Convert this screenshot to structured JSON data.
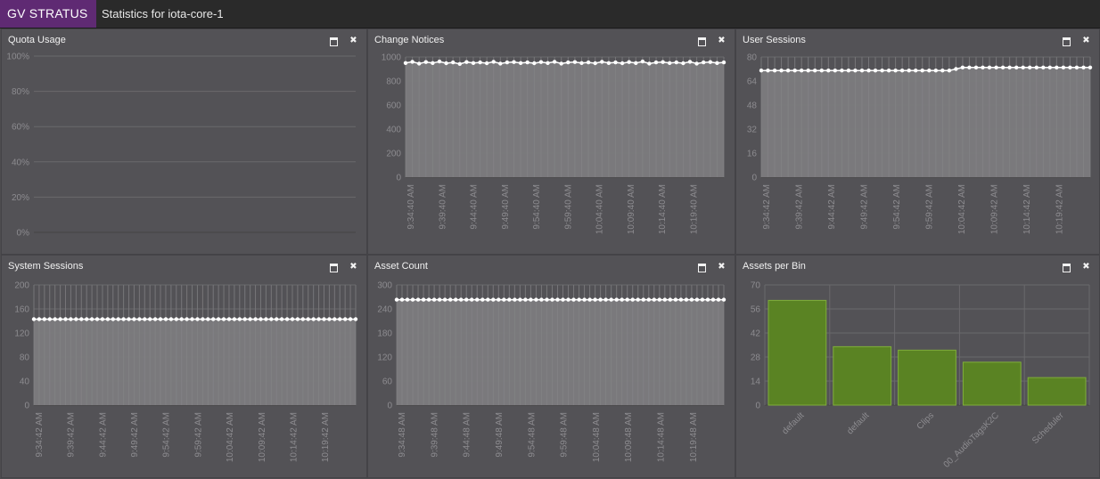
{
  "app": {
    "brand": "GV STRATUS",
    "title": "Statistics for iota-core-1"
  },
  "colors": {
    "brand": "#5f2a73",
    "series_line": "#ffffff",
    "area_fill": "#7c7b7e",
    "bar_fill": "#5a8323"
  },
  "icons": {
    "maximize": "window-maximize-icon",
    "close": "close-x-icon"
  },
  "panels": {
    "quota_usage": {
      "title": "Quota Usage"
    },
    "change_notices": {
      "title": "Change Notices"
    },
    "user_sessions": {
      "title": "User Sessions"
    },
    "system_sessions": {
      "title": "System Sessions"
    },
    "asset_count": {
      "title": "Asset Count"
    },
    "assets_per_bin": {
      "title": "Assets per Bin"
    }
  },
  "chart_data": [
    {
      "id": "quota_usage",
      "type": "line",
      "y_ticks": [
        "0%",
        "20%",
        "40%",
        "60%",
        "80%",
        "100%"
      ],
      "ylim": [
        0,
        100
      ],
      "series": [],
      "grid": "horizontal"
    },
    {
      "id": "change_notices",
      "type": "area",
      "x_ticks": [
        "9:34:40 AM",
        "9:39:40 AM",
        "9:44:40 AM",
        "9:49:40 AM",
        "9:54:40 AM",
        "9:59:40 AM",
        "10:04:40 AM",
        "10:09:40 AM",
        "10:14:40 AM",
        "10:19:40 AM"
      ],
      "y_ticks": [
        "0",
        "200",
        "400",
        "600",
        "800",
        "1000"
      ],
      "ylim": [
        0,
        1000
      ],
      "series": [
        {
          "values": [
            950,
            960,
            945,
            958,
            950,
            962,
            948,
            955,
            942,
            958,
            950,
            955,
            948,
            960,
            945,
            955,
            958,
            950,
            955,
            948,
            958,
            950,
            960,
            945,
            955,
            958,
            950,
            955,
            948,
            960,
            950,
            955,
            948,
            958,
            950,
            962,
            945,
            955,
            958,
            950,
            955,
            948,
            960,
            945,
            955,
            958,
            950,
            955
          ]
        }
      ],
      "grid": "both"
    },
    {
      "id": "user_sessions",
      "type": "area",
      "x_ticks": [
        "9:34:42 AM",
        "9:39:42 AM",
        "9:44:42 AM",
        "9:49:42 AM",
        "9:54:42 AM",
        "9:59:42 AM",
        "10:04:42 AM",
        "10:09:42 AM",
        "10:14:42 AM",
        "10:19:42 AM"
      ],
      "y_ticks": [
        "0",
        "16",
        "32",
        "48",
        "64",
        "80"
      ],
      "ylim": [
        0,
        80
      ],
      "series": [
        {
          "values": [
            71,
            71,
            71,
            71,
            71,
            71,
            71,
            71,
            71,
            71,
            71,
            71,
            71,
            71,
            71,
            71,
            71,
            71,
            71,
            71,
            71,
            71,
            71,
            71,
            71,
            71,
            71,
            71,
            71,
            72,
            73,
            73,
            73,
            73,
            73,
            73,
            73,
            73,
            73,
            73,
            73,
            73,
            73,
            73,
            73,
            73,
            73,
            73,
            73,
            73
          ]
        }
      ],
      "grid": "both"
    },
    {
      "id": "system_sessions",
      "type": "area",
      "x_ticks": [
        "9:34:42 AM",
        "9:39:42 AM",
        "9:44:42 AM",
        "9:49:42 AM",
        "9:54:42 AM",
        "9:59:42 AM",
        "10:04:42 AM",
        "10:09:42 AM",
        "10:14:42 AM",
        "10:19:42 AM"
      ],
      "y_ticks": [
        "0",
        "40",
        "80",
        "120",
        "160",
        "200"
      ],
      "ylim": [
        0,
        200
      ],
      "series": [
        {
          "values": [
            143,
            143,
            143,
            143,
            143,
            143,
            143,
            143,
            143,
            143,
            143,
            143,
            143,
            143,
            143,
            143,
            143,
            143,
            143,
            143,
            143,
            143,
            143,
            143,
            143,
            143,
            143,
            143,
            143,
            143,
            143,
            143,
            143,
            143,
            143,
            143,
            143,
            143,
            143,
            143,
            143,
            143,
            143,
            143,
            143,
            143,
            143,
            143,
            143,
            143,
            143,
            143,
            143,
            143,
            143,
            143,
            143,
            143,
            143,
            143,
            143,
            143
          ]
        }
      ],
      "grid": "both"
    },
    {
      "id": "asset_count",
      "type": "area",
      "x_ticks": [
        "9:34:48 AM",
        "9:39:48 AM",
        "9:44:48 AM",
        "9:49:48 AM",
        "9:54:48 AM",
        "9:59:48 AM",
        "10:04:48 AM",
        "10:09:48 AM",
        "10:14:48 AM",
        "10:19:48 AM"
      ],
      "y_ticks": [
        "0",
        "60",
        "120",
        "180",
        "240",
        "300"
      ],
      "ylim": [
        0,
        300
      ],
      "series": [
        {
          "values": [
            263,
            263,
            263,
            263,
            263,
            263,
            263,
            263,
            263,
            263,
            263,
            263,
            263,
            263,
            263,
            263,
            263,
            263,
            263,
            263,
            263,
            263,
            263,
            263,
            263,
            263,
            263,
            263,
            263,
            263,
            263,
            263,
            263,
            263,
            263,
            263,
            263,
            263,
            263,
            263,
            263,
            263,
            263,
            263,
            263,
            263,
            263,
            263,
            263,
            263,
            263,
            263,
            263,
            263,
            263,
            263,
            263,
            263,
            263,
            263,
            263,
            263
          ]
        }
      ],
      "grid": "both"
    },
    {
      "id": "assets_per_bin",
      "type": "bar",
      "categories": [
        "default",
        "default",
        "Clips",
        "00_AudioTagsK2C",
        "Scheduler"
      ],
      "values": [
        61,
        34,
        32,
        25,
        16
      ],
      "y_ticks": [
        "0",
        "14",
        "28",
        "42",
        "56",
        "70"
      ],
      "ylim": [
        0,
        70
      ],
      "grid": "both"
    }
  ]
}
